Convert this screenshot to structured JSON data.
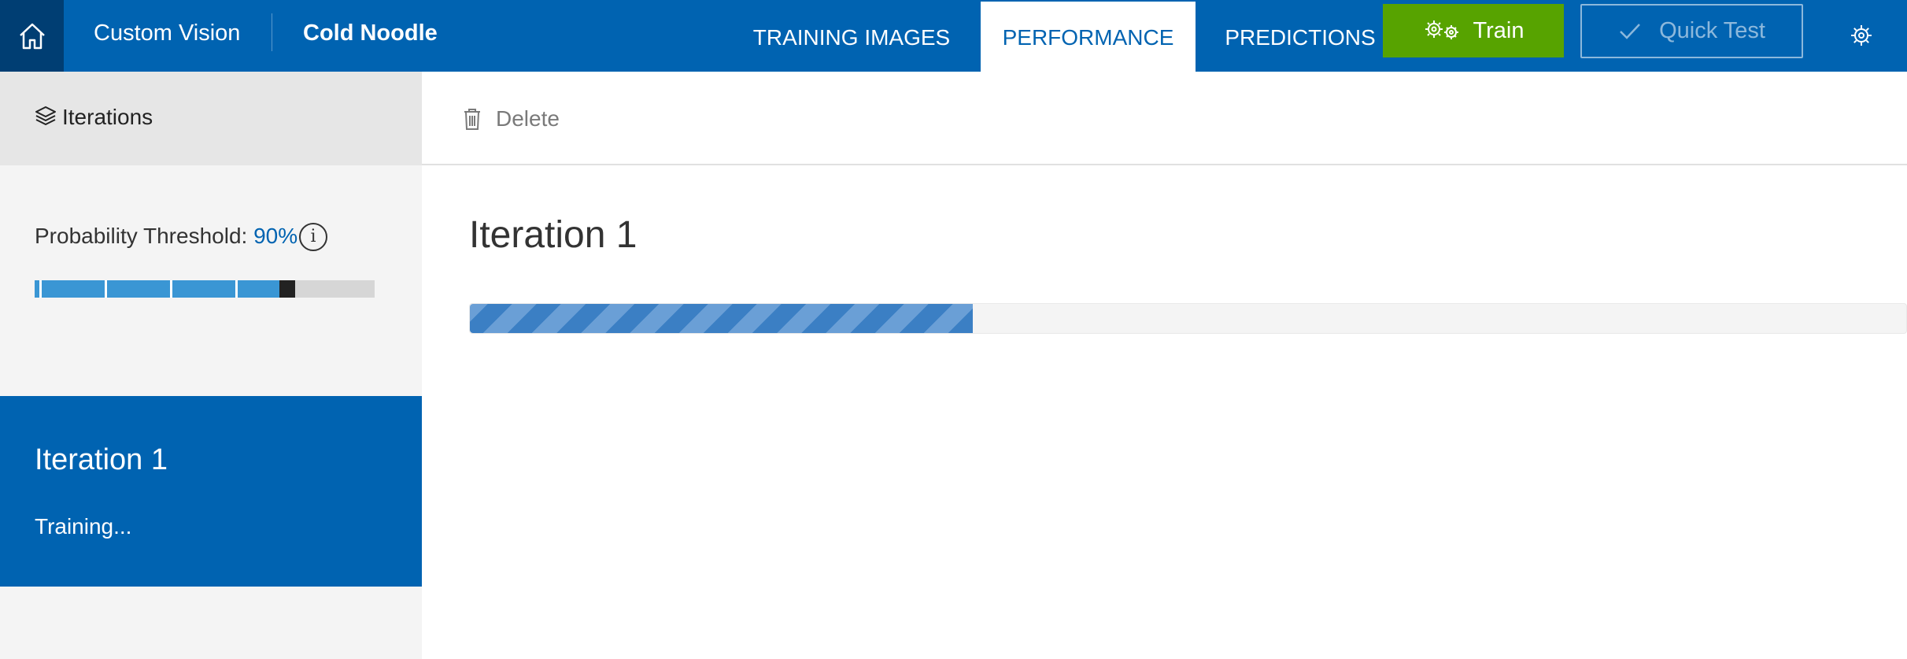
{
  "header": {
    "app_name": "Custom Vision",
    "project_name": "Cold Noodle",
    "tabs": [
      {
        "label": "TRAINING IMAGES",
        "active": false
      },
      {
        "label": "PERFORMANCE",
        "active": true
      },
      {
        "label": "PREDICTIONS",
        "active": false
      }
    ],
    "train_label": "Train",
    "quick_test_label": "Quick Test",
    "icons": {
      "home": "home-icon",
      "train": "gears-icon",
      "quick_test": "checkmark-icon",
      "settings": "gear-icon"
    }
  },
  "sidebar": {
    "header_label": "Iterations",
    "threshold": {
      "label": "Probability Threshold:",
      "value_text": "90%",
      "value_fraction": 0.9,
      "info_glyph": "i"
    },
    "iterations": [
      {
        "name": "Iteration 1",
        "status": "Training...",
        "selected": true
      }
    ]
  },
  "toolbar": {
    "delete_label": "Delete"
  },
  "main": {
    "title": "Iteration 1",
    "progress_fraction": 0.35
  },
  "colors": {
    "brand_blue": "#0063b1",
    "train_green": "#57a300",
    "threshold_blue": "#3a96d4"
  }
}
